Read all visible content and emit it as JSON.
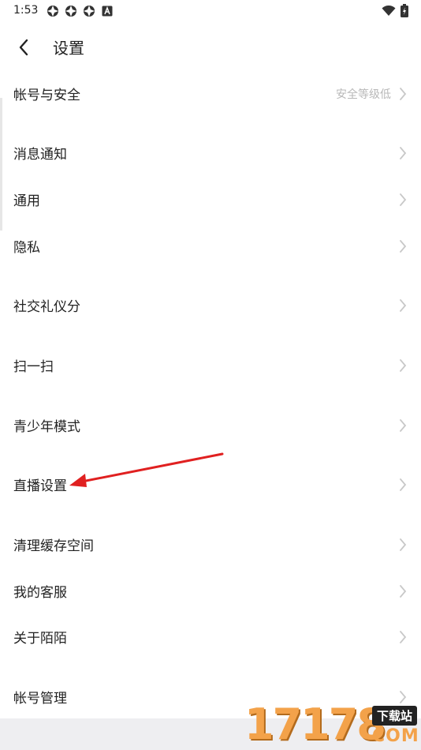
{
  "status_bar": {
    "time": "1:53",
    "left_icons": [
      "notification-icon",
      "notification-icon",
      "notification-icon",
      "a-icon"
    ],
    "right_icons": [
      "wifi-icon",
      "battery-icon"
    ]
  },
  "header": {
    "back_icon": "back-arrow-icon",
    "title": "设置"
  },
  "rows": [
    {
      "label": "帐号与安全",
      "value": "安全等级低"
    },
    {
      "label": "消息通知",
      "value": ""
    },
    {
      "label": "通用",
      "value": ""
    },
    {
      "label": "隐私",
      "value": ""
    },
    {
      "label": "社交礼仪分",
      "value": ""
    },
    {
      "label": "扫一扫",
      "value": ""
    },
    {
      "label": "青少年模式",
      "value": ""
    },
    {
      "label": "直播设置",
      "value": ""
    },
    {
      "label": "清理缓存空间",
      "value": ""
    },
    {
      "label": "我的客服",
      "value": ""
    },
    {
      "label": "关于陌陌",
      "value": ""
    },
    {
      "label": "帐号管理",
      "value": ""
    }
  ],
  "watermark": {
    "number": "17178",
    "badge": "下载站",
    "domain": "COM"
  },
  "colors": {
    "text": "#222222",
    "secondary_text": "#b8b8b8",
    "chevron": "#c8c8c8",
    "annotation_arrow": "#e02020",
    "bottom_bar": "#eeeef1"
  }
}
